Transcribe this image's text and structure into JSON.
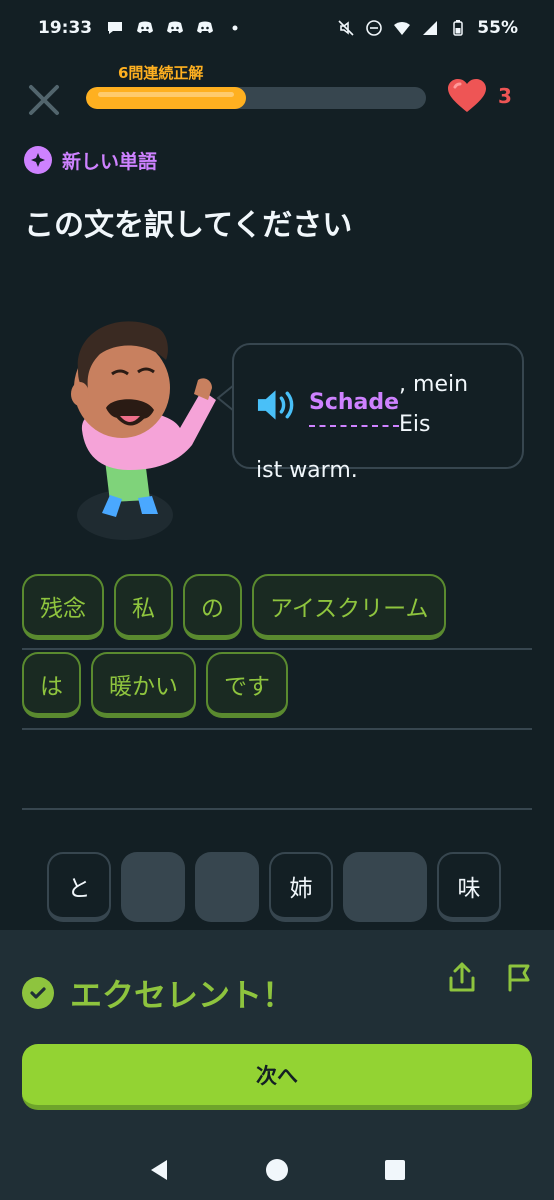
{
  "status_bar": {
    "time": "19:33",
    "battery": "55%",
    "notification_icons": [
      "chat-bubble-icon",
      "discord-icon",
      "discord-icon",
      "discord-icon",
      "dot-icon"
    ],
    "system_icons": [
      "mute-icon",
      "dnd-icon",
      "wifi-icon",
      "signal-icon",
      "battery-icon"
    ]
  },
  "lesson": {
    "streak_label": "6問連続正解",
    "progress": 0.47,
    "hearts": "3",
    "new_word_label": "新しい単語",
    "title": "この文を訳してください"
  },
  "sentence": {
    "words": [
      "Schade",
      ", mein Eis",
      "ist warm."
    ]
  },
  "answer_tiles": {
    "row1": [
      "残念",
      "私",
      "の",
      "アイスクリーム"
    ],
    "row2": [
      "は",
      "暖かい",
      "です"
    ]
  },
  "word_bank": [
    "と",
    "",
    "",
    "姉",
    "",
    "味"
  ],
  "feedback": {
    "text": "エクセレント！",
    "next_label": "次へ"
  },
  "colors": {
    "background": "#131f24",
    "accent_green": "#93d333",
    "streak_orange": "#ffb020",
    "new_word_purple": "#ce82ff",
    "heart_red": "#ee5555"
  }
}
